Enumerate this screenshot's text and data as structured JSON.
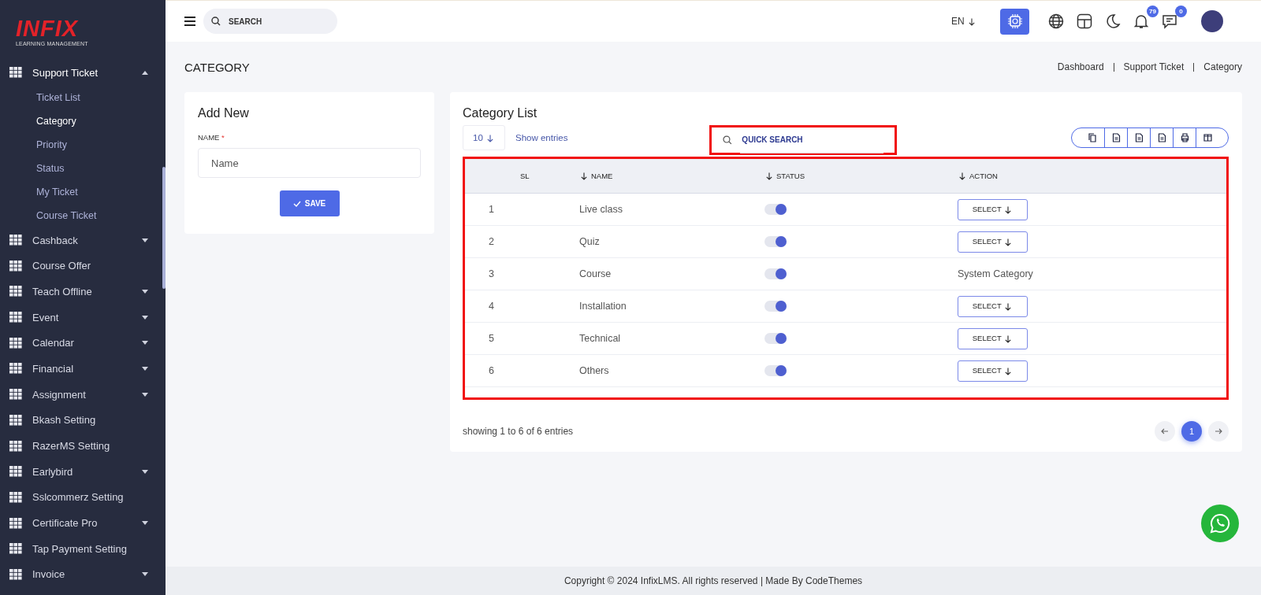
{
  "logo": {
    "brand": "INFIX",
    "tagline": "LEARNING MANAGEMENT"
  },
  "sidebar": {
    "items": [
      {
        "label": "Support Ticket",
        "expandable": true,
        "expanded": true,
        "children": [
          {
            "label": "Ticket List",
            "selected": false
          },
          {
            "label": "Category",
            "selected": true
          },
          {
            "label": "Priority",
            "selected": false
          },
          {
            "label": "Status",
            "selected": false
          },
          {
            "label": "My Ticket",
            "selected": false
          },
          {
            "label": "Course Ticket",
            "selected": false
          }
        ]
      },
      {
        "label": "Cashback",
        "expandable": true,
        "expanded": false
      },
      {
        "label": "Course Offer",
        "expandable": false
      },
      {
        "label": "Teach Offline",
        "expandable": true,
        "expanded": false
      },
      {
        "label": "Event",
        "expandable": true,
        "expanded": false
      },
      {
        "label": "Calendar",
        "expandable": true,
        "expanded": false
      },
      {
        "label": "Financial",
        "expandable": true,
        "expanded": false
      },
      {
        "label": "Assignment",
        "expandable": true,
        "expanded": false
      },
      {
        "label": "Bkash Setting",
        "expandable": false
      },
      {
        "label": "RazerMS Setting",
        "expandable": false
      },
      {
        "label": "Earlybird",
        "expandable": true,
        "expanded": false
      },
      {
        "label": "Sslcommerz Setting",
        "expandable": false
      },
      {
        "label": "Certificate Pro",
        "expandable": true,
        "expanded": false
      },
      {
        "label": "Tap Payment Setting",
        "expandable": false
      },
      {
        "label": "Invoice",
        "expandable": true,
        "expanded": false
      }
    ]
  },
  "topbar": {
    "search": {
      "placeholder": "SEARCH"
    },
    "language": "EN",
    "notifications": "79",
    "messages": "0"
  },
  "page": {
    "title": "CATEGORY",
    "breadcrumb": [
      "Dashboard",
      "Support Ticket",
      "Category"
    ]
  },
  "add_new": {
    "title": "Add New",
    "field_label": "NAME",
    "required_mark": "*",
    "placeholder": "Name",
    "button": "SAVE"
  },
  "list": {
    "title": "Category List",
    "entries": "10",
    "entries_label": "Show entries",
    "quick_search": {
      "placeholder": "QUICK SEARCH",
      "highlighted": true
    },
    "table_highlighted": true,
    "columns": [
      {
        "label": "SL",
        "sortable": false
      },
      {
        "label": "NAME",
        "sortable": true
      },
      {
        "label": "STATUS",
        "sortable": true
      },
      {
        "label": "ACTION",
        "sortable": true
      }
    ],
    "rows": [
      {
        "sl": "1",
        "name": "Live class",
        "enabled": true,
        "action": {
          "kind": "button",
          "label": "SELECT"
        }
      },
      {
        "sl": "2",
        "name": "Quiz",
        "enabled": true,
        "action": {
          "kind": "button",
          "label": "SELECT"
        }
      },
      {
        "sl": "3",
        "name": "Course",
        "enabled": true,
        "action": {
          "kind": "text",
          "label": "System Category"
        }
      },
      {
        "sl": "4",
        "name": "Installation",
        "enabled": true,
        "action": {
          "kind": "button",
          "label": "SELECT"
        }
      },
      {
        "sl": "5",
        "name": "Technical",
        "enabled": true,
        "action": {
          "kind": "button",
          "label": "SELECT"
        }
      },
      {
        "sl": "6",
        "name": "Others",
        "enabled": true,
        "action": {
          "kind": "button",
          "label": "SELECT"
        }
      }
    ],
    "summary": "showing 1 to 6 of 6 entries",
    "pages": [
      {
        "label": "1",
        "selected": true
      }
    ]
  },
  "footer": "Copyright © 2024 InfixLMS. All rights reserved | Made By CodeThemes"
}
